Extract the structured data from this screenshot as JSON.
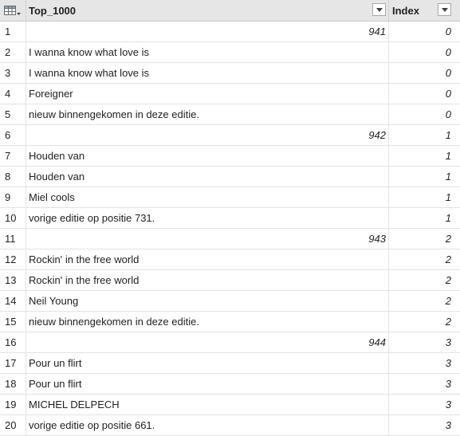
{
  "columns": {
    "col1": "Top_1000",
    "col2": "Index"
  },
  "icons": {
    "corner": "table-icon",
    "filter": "filter-dropdown-icon"
  },
  "colors": {
    "header_bg": "#e6e6e6",
    "grid_line": "#e3e3e3"
  },
  "rows": [
    {
      "n": "1",
      "value": "941",
      "numeric": true,
      "index": "0"
    },
    {
      "n": "2",
      "value": "I wanna know what love is",
      "numeric": false,
      "index": "0"
    },
    {
      "n": "3",
      "value": "I wanna know what love is",
      "numeric": false,
      "index": "0"
    },
    {
      "n": "4",
      "value": "Foreigner",
      "numeric": false,
      "index": "0"
    },
    {
      "n": "5",
      "value": "nieuw binnengekomen in deze editie.",
      "numeric": false,
      "index": "0"
    },
    {
      "n": "6",
      "value": "942",
      "numeric": true,
      "index": "1"
    },
    {
      "n": "7",
      "value": "Houden van",
      "numeric": false,
      "index": "1"
    },
    {
      "n": "8",
      "value": "Houden van",
      "numeric": false,
      "index": "1"
    },
    {
      "n": "9",
      "value": "Miel cools",
      "numeric": false,
      "index": "1"
    },
    {
      "n": "10",
      "value": "vorige editie op positie 731.",
      "numeric": false,
      "index": "1"
    },
    {
      "n": "11",
      "value": "943",
      "numeric": true,
      "index": "2"
    },
    {
      "n": "12",
      "value": "Rockin' in the free world",
      "numeric": false,
      "index": "2"
    },
    {
      "n": "13",
      "value": "Rockin' in the free world",
      "numeric": false,
      "index": "2"
    },
    {
      "n": "14",
      "value": "Neil Young",
      "numeric": false,
      "index": "2"
    },
    {
      "n": "15",
      "value": "nieuw binnengekomen in deze editie.",
      "numeric": false,
      "index": "2"
    },
    {
      "n": "16",
      "value": "944",
      "numeric": true,
      "index": "3"
    },
    {
      "n": "17",
      "value": "Pour un flirt",
      "numeric": false,
      "index": "3"
    },
    {
      "n": "18",
      "value": "Pour un flirt",
      "numeric": false,
      "index": "3"
    },
    {
      "n": "19",
      "value": "MICHEL DELPECH",
      "numeric": false,
      "index": "3"
    },
    {
      "n": "20",
      "value": "vorige editie op positie 661.",
      "numeric": false,
      "index": "3"
    }
  ]
}
